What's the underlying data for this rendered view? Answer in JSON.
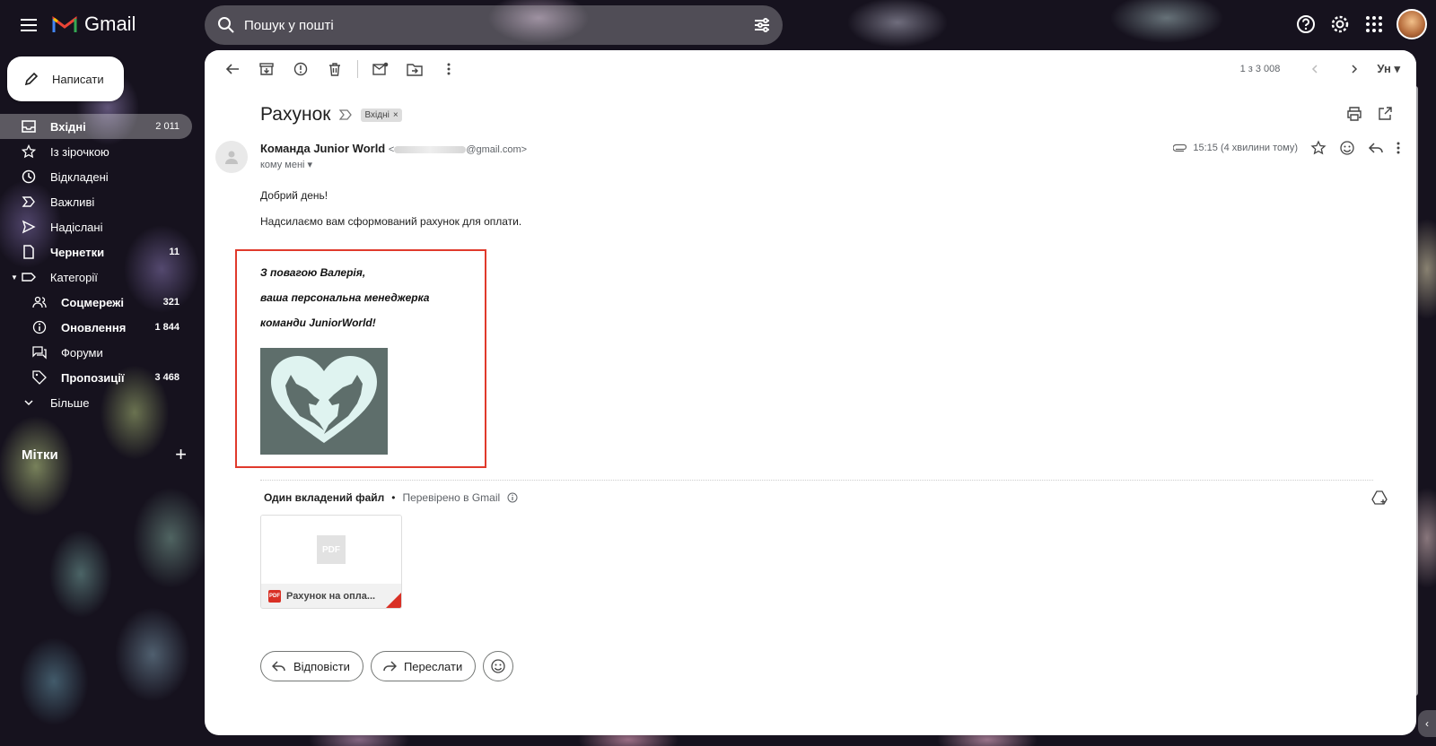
{
  "app": {
    "name": "Gmail"
  },
  "search": {
    "placeholder": "Пошук у пошті"
  },
  "compose": {
    "label": "Написати"
  },
  "sidebar": {
    "items": [
      {
        "label": "Вхідні",
        "count": "2 011",
        "icon": "inbox-icon"
      },
      {
        "label": "Із зірочкою",
        "count": "",
        "icon": "star-icon"
      },
      {
        "label": "Відкладені",
        "count": "",
        "icon": "clock-icon"
      },
      {
        "label": "Важливі",
        "count": "",
        "icon": "important-icon"
      },
      {
        "label": "Надіслані",
        "count": "",
        "icon": "send-icon"
      },
      {
        "label": "Чернетки",
        "count": "11",
        "icon": "draft-icon"
      },
      {
        "label": "Категорії",
        "count": "",
        "icon": "label-icon"
      },
      {
        "label": "Соцмережі",
        "count": "321",
        "icon": "people-icon"
      },
      {
        "label": "Оновлення",
        "count": "1 844",
        "icon": "info-icon"
      },
      {
        "label": "Форуми",
        "count": "",
        "icon": "forum-icon"
      },
      {
        "label": "Пропозиції",
        "count": "3 468",
        "icon": "tag-icon"
      },
      {
        "label": "Більше",
        "count": "",
        "icon": "chevron-down-icon"
      }
    ],
    "labels_title": "Мітки"
  },
  "toolbar": {
    "pager": "1 з 3 008",
    "input_tool": "Ун"
  },
  "email": {
    "subject": "Рахунок",
    "label_chip": "Вхідні",
    "sender_name": "Команда Junior World",
    "sender_email_open": "<",
    "sender_email_domain": "@gmail.com>",
    "to": "кому мені",
    "time": "15:15 (4 хвилини тому)",
    "greeting": "Добрий день!",
    "body": "Надсилаємо вам сформований рахунок для оплати.",
    "signature": [
      "З повагою Валерія,",
      "ваша персональна менеджерка",
      "команди JuniorWorld!"
    ]
  },
  "attachments": {
    "title": "Один вкладений файл",
    "separator": "•",
    "checked": "Перевірено в Gmail",
    "file_name": "Рахунок на опла...",
    "thumb_text": "PDF",
    "badge_text": "PDF"
  },
  "actions": {
    "reply": "Відповісти",
    "forward": "Переслати"
  },
  "colors": {
    "accent_red": "#e03a2c",
    "logo_bg": "#5e6e6b",
    "heart": "#dff3f0"
  }
}
